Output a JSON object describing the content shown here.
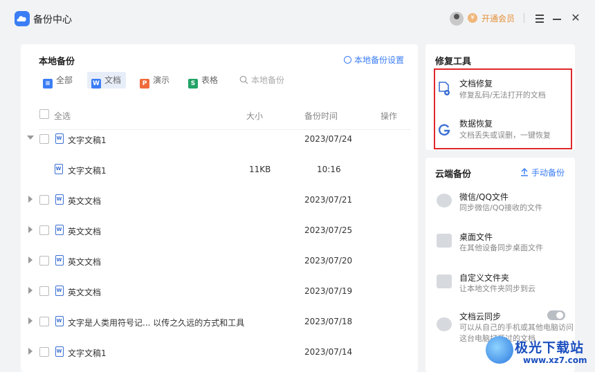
{
  "app": {
    "title": "备份中心",
    "vip_label": "开通会员",
    "close_glyph": "✕"
  },
  "local": {
    "title": "本地备份",
    "settings_label": "本地备份设置",
    "tabs": [
      {
        "label": "全部",
        "icon": "list-icon",
        "color": "#3b7df5",
        "glyph": "≡",
        "active": false
      },
      {
        "label": "文档",
        "icon": "word-icon",
        "color": "#3b7df5",
        "glyph": "W",
        "active": true
      },
      {
        "label": "演示",
        "icon": "ppt-icon",
        "color": "#ef6b3b",
        "glyph": "P",
        "active": false
      },
      {
        "label": "表格",
        "icon": "sheet-icon",
        "color": "#21a366",
        "glyph": "S",
        "active": false
      }
    ],
    "search_placeholder": "本地备份",
    "columns": {
      "select_all": "全选",
      "size": "大小",
      "time": "备份时间",
      "action": "操作"
    },
    "rows": [
      {
        "name": "文字文稿1",
        "size": "",
        "date": "2023/07/24",
        "expanded": true,
        "child": false
      },
      {
        "name": "文字文稿1",
        "size": "11KB",
        "date": "10:16",
        "expanded": false,
        "child": true
      },
      {
        "name": "英文文档",
        "size": "",
        "date": "2023/07/21",
        "expanded": false,
        "child": false
      },
      {
        "name": "英文文档",
        "size": "",
        "date": "2023/07/25",
        "expanded": false,
        "child": false
      },
      {
        "name": "英文文档",
        "size": "",
        "date": "2023/07/20",
        "expanded": false,
        "child": false
      },
      {
        "name": "英文文档",
        "size": "",
        "date": "2023/07/19",
        "expanded": false,
        "child": false
      },
      {
        "name": "文字是人类用符号记... 以传之久远的方式和工具",
        "size": "",
        "date": "2023/07/18",
        "expanded": false,
        "child": false
      },
      {
        "name": "文字文稿1",
        "size": "",
        "date": "2023/07/14",
        "expanded": false,
        "child": false
      }
    ]
  },
  "repair": {
    "title": "修复工具",
    "items": [
      {
        "title": "文档修复",
        "subtitle": "修复乱码/无法打开的文档",
        "icon": "doc-repair-icon"
      },
      {
        "title": "数据恢复",
        "subtitle": "文档丢失或误删，一键恢复",
        "icon": "data-recovery-icon"
      }
    ]
  },
  "cloud": {
    "title": "云端备份",
    "manual_label": "手动备份",
    "items": [
      {
        "title": "微信/QQ文件",
        "subtitle": "同步微信/QQ接收的文件",
        "icon": "chat-icon"
      },
      {
        "title": "桌面文件",
        "subtitle": "在其他设备同步桌面文件",
        "icon": "desktop-icon"
      },
      {
        "title": "自定义文件夹",
        "subtitle": "让本地文件夹同步到云",
        "icon": "folder-icon"
      },
      {
        "title": "文档云同步",
        "subtitle": "可以从自己的手机或其他电脑访问这台电脑打开过的文档",
        "icon": "cloud-upload-icon",
        "toggle": false
      }
    ]
  },
  "watermark": {
    "main": "极光下载站",
    "url": "www.xz7.com"
  }
}
